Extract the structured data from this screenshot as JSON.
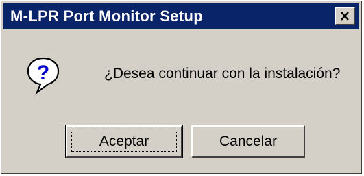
{
  "dialog": {
    "title": "M-LPR Port Monitor Setup",
    "message": "¿Desea continuar con la instalación?",
    "icon": "question-icon",
    "close_icon": "close-icon"
  },
  "buttons": {
    "ok_label": "Aceptar",
    "cancel_label": "Cancelar"
  },
  "colors": {
    "titlebar": "#0a246a",
    "face": "#d4d0c8",
    "title_text": "#ffffff"
  }
}
